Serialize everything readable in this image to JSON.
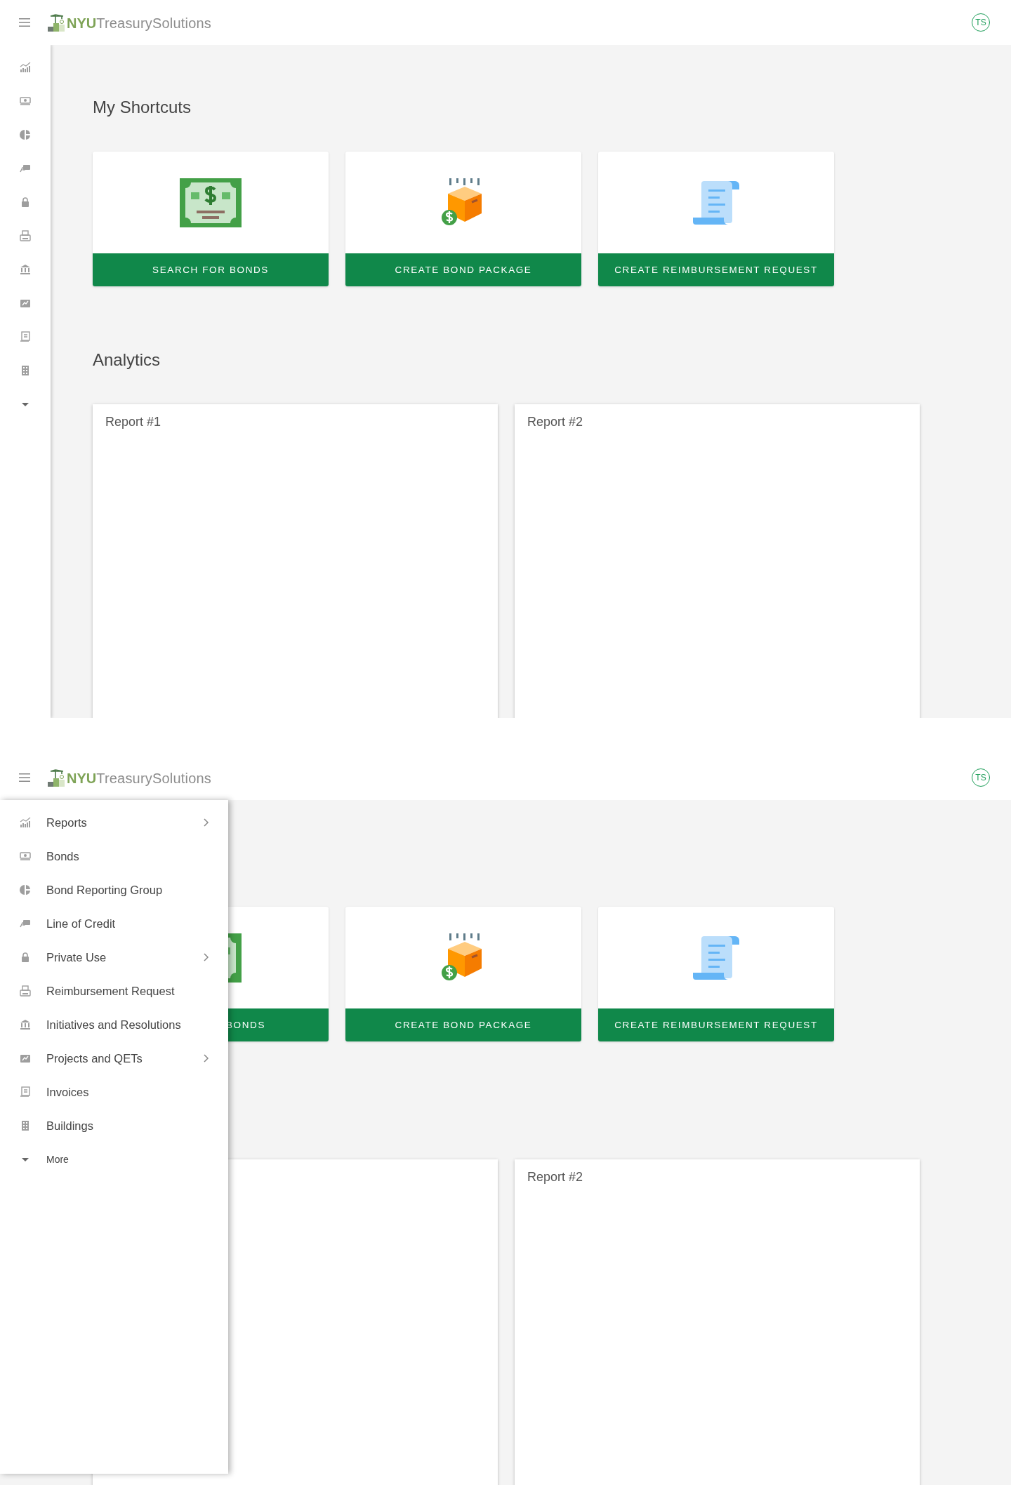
{
  "screens": [
    {
      "header": {
        "brand": "NYU",
        "product": "TreasurySolutions",
        "avatar": "TS"
      },
      "nav": {
        "expanded": false
      },
      "shortcuts_title": "My Shortcuts",
      "shortcuts": [
        {
          "label": "SEARCH FOR BONDS"
        },
        {
          "label": "CREATE BOND PACKAGE"
        },
        {
          "label": "CREATE REIMBURSEMENT REQUEST"
        }
      ],
      "analytics_title": "Analytics",
      "reports": [
        {
          "kind": "report",
          "title": "Report #1"
        },
        {
          "kind": "report",
          "title": "Report #2"
        }
      ]
    },
    {
      "header": {
        "brand": "NYU",
        "product": "TreasurySolutions",
        "avatar": "TS"
      },
      "nav": {
        "expanded": true,
        "items": [
          {
            "label": "Reports",
            "submenu": true
          },
          {
            "label": "Bonds",
            "submenu": false
          },
          {
            "label": "Bond Reporting Group",
            "submenu": false
          },
          {
            "label": "Line of Credit",
            "submenu": false
          },
          {
            "label": "Private Use",
            "submenu": true
          },
          {
            "label": "Reimbursement Request",
            "submenu": false
          },
          {
            "label": "Initiatives and Resolutions",
            "submenu": false
          },
          {
            "label": "Projects and QETs",
            "submenu": true
          },
          {
            "label": "Invoices",
            "submenu": false
          },
          {
            "label": "Buildings",
            "submenu": false
          }
        ],
        "more": "More"
      },
      "shortcuts": [
        {
          "label": "BONDS"
        },
        {
          "label": "CREATE BOND PACKAGE"
        },
        {
          "label": "CREATE REIMBURSEMENT REQUEST"
        }
      ],
      "reports": [
        {
          "kind": "report"
        },
        {
          "kind": "report",
          "title": "Report #2"
        }
      ]
    }
  ]
}
